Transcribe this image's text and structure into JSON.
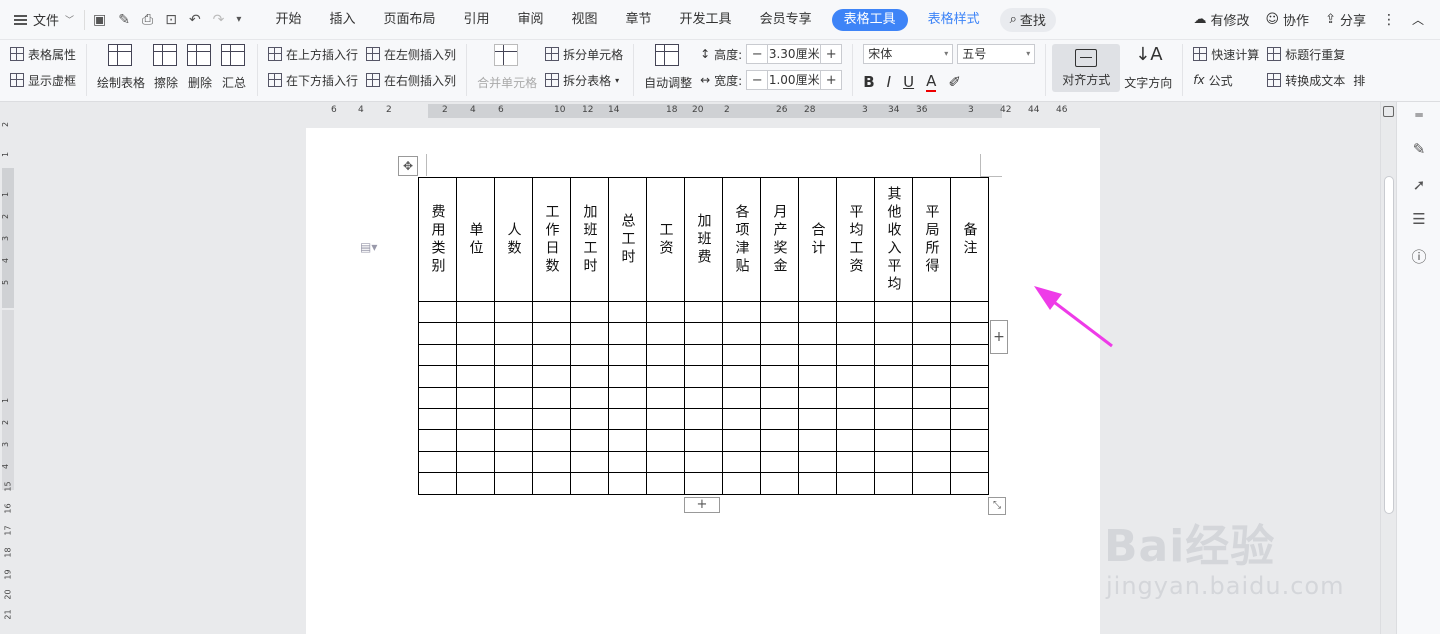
{
  "menubar": {
    "file_label": "文件",
    "tabs": [
      "开始",
      "插入",
      "页面布局",
      "引用",
      "审阅",
      "视图",
      "章节",
      "开发工具",
      "会员专享"
    ],
    "context_tabs": [
      "表格工具",
      "表格样式"
    ],
    "search_label": "查找",
    "right": [
      "有修改",
      "协作",
      "分享"
    ]
  },
  "ribbon": {
    "table_props": "表格属性",
    "show_gridlines": "显示虚框",
    "draw_table": "绘制表格",
    "erase": "擦除",
    "delete": "删除",
    "summary": "汇总",
    "insert_row_above": "在上方插入行",
    "insert_row_below": "在下方插入行",
    "insert_col_left": "在左侧插入列",
    "insert_col_right": "在右侧插入列",
    "merge_cells": "合并单元格",
    "split_cells": "拆分单元格",
    "split_table": "拆分表格",
    "auto_fit": "自动调整",
    "height_label": "高度:",
    "height_value": "3.30厘米",
    "width_label": "宽度:",
    "width_value": "1.00厘米",
    "font_name": "宋体",
    "font_size": "五号",
    "align_label": "对齐方式",
    "text_dir": "文字方向",
    "quick_calc": "快速计算",
    "formula": "公式",
    "header_repeat": "标题行重复",
    "to_text": "转换成文本",
    "more": "排"
  },
  "ruler": {
    "h_ticks": [
      "6",
      "4",
      "2",
      "2",
      "4",
      "6",
      "10",
      "12",
      "14",
      "18",
      "20",
      "2",
      "26",
      "28",
      "3",
      "34",
      "36",
      "3",
      "42",
      "44",
      "46"
    ],
    "v_ticks": [
      "2",
      "1",
      "1",
      "2",
      "3",
      "4",
      "5",
      "1",
      "2",
      "3",
      "4",
      "15",
      "16",
      "17",
      "18",
      "19",
      "20",
      "21"
    ]
  },
  "table": {
    "headers": [
      "费用类别",
      "单位",
      "人数",
      "工作日数",
      "加班工时",
      "总工时",
      "工资",
      "加班费",
      "各项津贴",
      "月产奖金",
      "合计",
      "平均工资",
      "其他收入平均",
      "平局所得",
      "备注"
    ],
    "empty_rows": 9
  },
  "annotation": {
    "arrow_color": "#ee3be8"
  },
  "watermark": {
    "brand": "Bai经验",
    "url": "jingyan.baidu.com"
  },
  "colors": {
    "accent": "#3e84f7"
  }
}
